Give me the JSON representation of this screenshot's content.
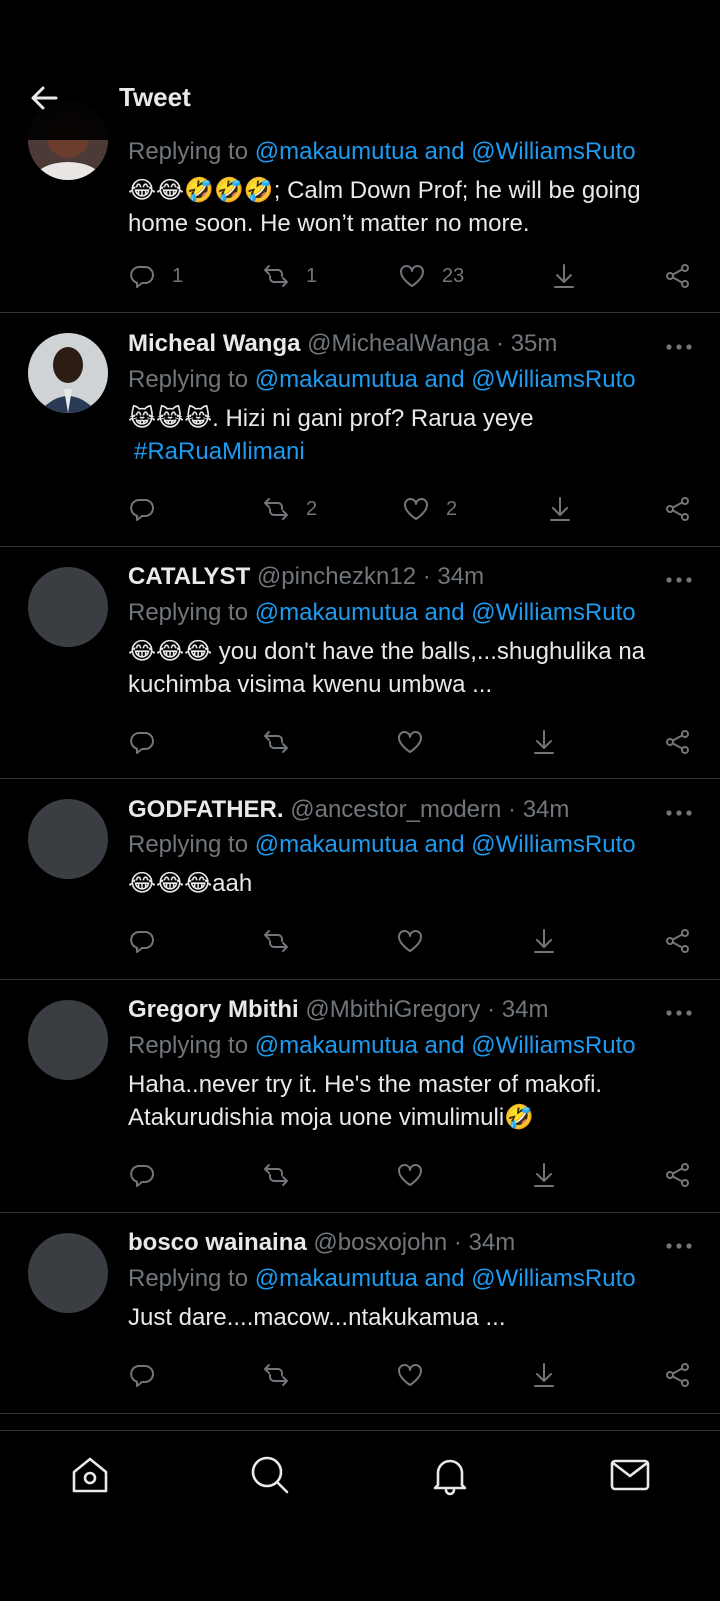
{
  "header": {
    "title": "Tweet"
  },
  "tweets": [
    {
      "name": "",
      "handle": "",
      "time": "",
      "replying_prefix": "Replying to ",
      "mentions": "@makaumutua and @WilliamsRuto",
      "text_lines": [
        "😂😂🤣🤣🤣; Calm Down Prof; he will be going",
        "home soon. He won’t matter no more."
      ],
      "hashtag": "",
      "replies": "1",
      "retweets": "1",
      "likes": "23"
    },
    {
      "name": "Micheal Wanga",
      "handle": "@MichealWanga",
      "time": "· 35m",
      "replying_prefix": "Replying to ",
      "mentions": "@makaumutua and @WilliamsRuto",
      "text_lines": [
        "😹😹😹. Hizi ni gani prof? Rarua yeye"
      ],
      "hashtag": "#RaRuaMlimani",
      "replies": "",
      "retweets": "2",
      "likes": "2"
    },
    {
      "name": "CATALYST",
      "handle": "@pinchezkn12",
      "time": "· 34m",
      "replying_prefix": "Replying to ",
      "mentions": "@makaumutua and @WilliamsRuto",
      "text_lines": [
        "😂😂😂 you don't have the balls,...shughulika na",
        "kuchimba visima kwenu umbwa ..."
      ],
      "hashtag": "",
      "replies": "",
      "retweets": "",
      "likes": ""
    },
    {
      "name": "GODFATHER.",
      "handle": "@ancestor_modern",
      "time": "· 34m",
      "replying_prefix": "Replying to ",
      "mentions": "@makaumutua and @WilliamsRuto",
      "text_lines": [
        "😂😂😂aah"
      ],
      "hashtag": "",
      "replies": "",
      "retweets": "",
      "likes": ""
    },
    {
      "name": "Gregory Mbithi",
      "handle": "@MbithiGregory",
      "time": "· 34m",
      "replying_prefix": "Replying to ",
      "mentions": "@makaumutua and @WilliamsRuto",
      "text_lines": [
        "Haha..never try it. He's the master of makofi.",
        "Atakurudishia moja uone  vimulimuli🤣"
      ],
      "hashtag": "",
      "replies": "",
      "retweets": "",
      "likes": ""
    },
    {
      "name": "bosco wainaina",
      "handle": "@bosxojohn",
      "time": "· 34m",
      "replying_prefix": "Replying to ",
      "mentions": "@makaumutua and @WilliamsRuto",
      "text_lines": [
        "Just dare....macow...ntakukamua ..."
      ],
      "hashtag": "",
      "replies": "",
      "retweets": "",
      "likes": ""
    }
  ],
  "icons": {
    "back": "arrow-left-icon",
    "more": "more-horizontal-icon",
    "reply": "comment-icon",
    "retweet": "retweet-icon",
    "like": "heart-icon",
    "save": "download-icon",
    "share": "share-icon",
    "nav": [
      "home-icon",
      "search-icon",
      "bell-icon",
      "mail-icon"
    ]
  },
  "colors": {
    "background": "#000000",
    "text": "#e7e9ea",
    "muted": "#71767b",
    "accent": "#1d9bf0",
    "divider": "#2f3336"
  }
}
